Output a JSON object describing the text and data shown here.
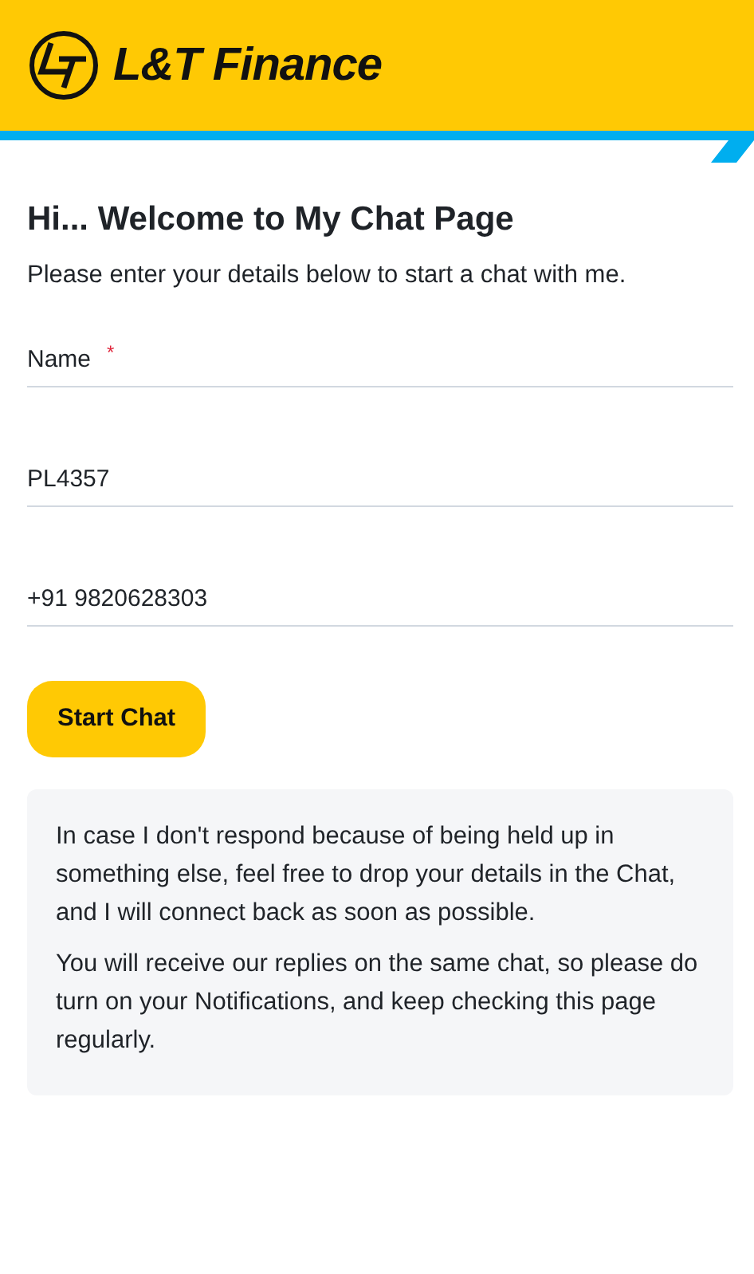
{
  "header": {
    "brand": "L&T Finance"
  },
  "title": "Hi... Welcome to My Chat Page",
  "subtitle": "Please enter your details below to start a chat with me.",
  "fields": [
    {
      "placeholder": "Name",
      "required_mark": "*"
    },
    {
      "value": "PL4357"
    },
    {
      "value": "+91 9820628303"
    }
  ],
  "button": "Start Chat",
  "notice": [
    "In case I don't respond because of being held up in something else, feel free to drop your details in the Chat, and I will connect back as soon as possible.",
    "You will receive our replies on the same chat, so please do turn on your Notifications, and keep checking this page regularly."
  ]
}
